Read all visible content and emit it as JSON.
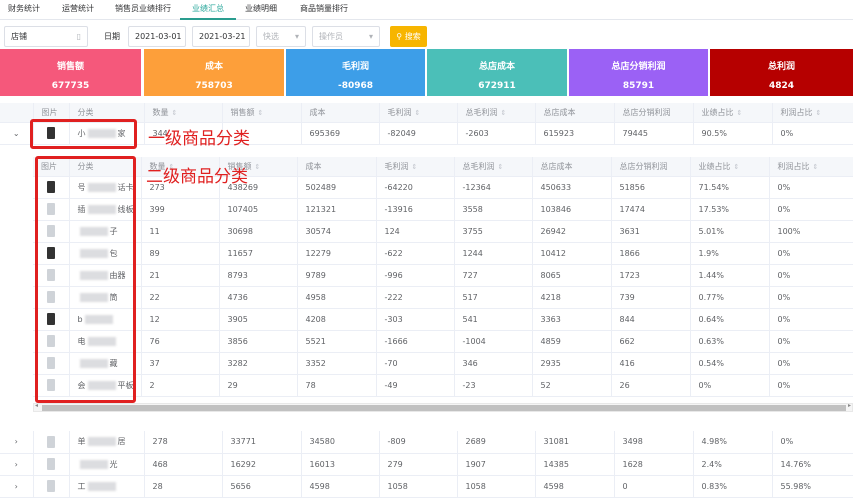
{
  "tabs": [
    {
      "label": "财务统计",
      "active": false
    },
    {
      "label": "运营统计",
      "active": false
    },
    {
      "label": "销售员业绩排行",
      "active": false
    },
    {
      "label": "业绩汇总",
      "active": true
    },
    {
      "label": "业绩明细",
      "active": false
    },
    {
      "label": "商品销量排行",
      "active": false
    }
  ],
  "filters": {
    "store_placeholder": "店铺",
    "date_label": "日期",
    "date_start": "2021-03-01",
    "date_end": "2021-03-21",
    "quick_placeholder": "快选",
    "operator_placeholder": "操作员",
    "search_label": "搜索"
  },
  "summary_cards": [
    {
      "title": "销售额",
      "value": "677735",
      "color": "#f5587b"
    },
    {
      "title": "成本",
      "value": "758703",
      "color": "#fd9f3a"
    },
    {
      "title": "毛利润",
      "value": "-80968",
      "color": "#3d9ee8"
    },
    {
      "title": "总店成本",
      "value": "672911",
      "color": "#4bbfb8"
    },
    {
      "title": "总店分销利润",
      "value": "85791",
      "color": "#9b61f5"
    },
    {
      "title": "总利润",
      "value": "4824",
      "color": "#b60000"
    }
  ],
  "columns": [
    "图片",
    "分类",
    "数量",
    "销售额",
    "成本",
    "毛利润",
    "总毛利润",
    "总店成本",
    "总店分销利润",
    "业绩占比",
    "利润占比"
  ],
  "sortable": [
    false,
    false,
    true,
    true,
    false,
    true,
    true,
    false,
    false,
    true,
    true
  ],
  "top_rows": [
    {
      "expanded": true,
      "category": [
        "小",
        "家"
      ],
      "qty": "344",
      "sales": "",
      "cost": "695369",
      "gross": "-82049",
      "total_gross": "-2603",
      "hq_cost": "615923",
      "hq_profit": "79445",
      "sales_ratio": "90.5%",
      "profit_ratio": "0%"
    }
  ],
  "sub_rows": [
    {
      "category": [
        "号",
        "话卡"
      ],
      "qty": "273",
      "sales": "438269",
      "cost": "502489",
      "gross": "-64220",
      "total_gross": "-12364",
      "hq_cost": "450633",
      "hq_profit": "51856",
      "sales_ratio": "71.54%",
      "profit_ratio": "0%"
    },
    {
      "category": [
        "插",
        "线板"
      ],
      "qty": "399",
      "sales": "107405",
      "cost": "121321",
      "gross": "-13916",
      "total_gross": "3558",
      "hq_cost": "103846",
      "hq_profit": "17474",
      "sales_ratio": "17.53%",
      "profit_ratio": "0%"
    },
    {
      "category": [
        "",
        "子"
      ],
      "qty": "11",
      "sales": "30698",
      "cost": "30574",
      "gross": "124",
      "total_gross": "3755",
      "hq_cost": "26942",
      "hq_profit": "3631",
      "sales_ratio": "5.01%",
      "profit_ratio": "100%"
    },
    {
      "category": [
        "",
        "包"
      ],
      "qty": "89",
      "sales": "11657",
      "cost": "12279",
      "gross": "-622",
      "total_gross": "1244",
      "hq_cost": "10412",
      "hq_profit": "1866",
      "sales_ratio": "1.9%",
      "profit_ratio": "0%"
    },
    {
      "category": [
        "",
        "由器"
      ],
      "qty": "21",
      "sales": "8793",
      "cost": "9789",
      "gross": "-996",
      "total_gross": "727",
      "hq_cost": "8065",
      "hq_profit": "1723",
      "sales_ratio": "1.44%",
      "profit_ratio": "0%"
    },
    {
      "category": [
        "",
        "筒"
      ],
      "qty": "22",
      "sales": "4736",
      "cost": "4958",
      "gross": "-222",
      "total_gross": "517",
      "hq_cost": "4218",
      "hq_profit": "739",
      "sales_ratio": "0.77%",
      "profit_ratio": "0%"
    },
    {
      "category": [
        "b",
        ""
      ],
      "qty": "12",
      "sales": "3905",
      "cost": "4208",
      "gross": "-303",
      "total_gross": "541",
      "hq_cost": "3363",
      "hq_profit": "844",
      "sales_ratio": "0.64%",
      "profit_ratio": "0%"
    },
    {
      "category": [
        "电",
        ""
      ],
      "qty": "76",
      "sales": "3856",
      "cost": "5521",
      "gross": "-1666",
      "total_gross": "-1004",
      "hq_cost": "4859",
      "hq_profit": "662",
      "sales_ratio": "0.63%",
      "profit_ratio": "0%"
    },
    {
      "category": [
        "",
        "藏"
      ],
      "qty": "37",
      "sales": "3282",
      "cost": "3352",
      "gross": "-70",
      "total_gross": "346",
      "hq_cost": "2935",
      "hq_profit": "416",
      "sales_ratio": "0.54%",
      "profit_ratio": "0%"
    },
    {
      "category": [
        "会",
        "平板"
      ],
      "qty": "2",
      "sales": "29",
      "cost": "78",
      "gross": "-49",
      "total_gross": "-23",
      "hq_cost": "52",
      "hq_profit": "26",
      "sales_ratio": "0%",
      "profit_ratio": "0%"
    }
  ],
  "bottom_rows": [
    {
      "category": [
        "单",
        "居"
      ],
      "qty": "278",
      "sales": "33771",
      "cost": "34580",
      "gross": "-809",
      "total_gross": "2689",
      "hq_cost": "31081",
      "hq_profit": "3498",
      "sales_ratio": "4.98%",
      "profit_ratio": "0%"
    },
    {
      "category": [
        "",
        "光"
      ],
      "qty": "468",
      "sales": "16292",
      "cost": "16013",
      "gross": "279",
      "total_gross": "1907",
      "hq_cost": "14385",
      "hq_profit": "1628",
      "sales_ratio": "2.4%",
      "profit_ratio": "14.76%"
    },
    {
      "category": [
        "工",
        ""
      ],
      "qty": "28",
      "sales": "5656",
      "cost": "4598",
      "gross": "1058",
      "total_gross": "1058",
      "hq_cost": "4598",
      "hq_profit": "0",
      "sales_ratio": "0.83%",
      "profit_ratio": "55.98%"
    }
  ],
  "annotations": {
    "level1": "一级商品分类",
    "level2": "二级商品分类"
  }
}
